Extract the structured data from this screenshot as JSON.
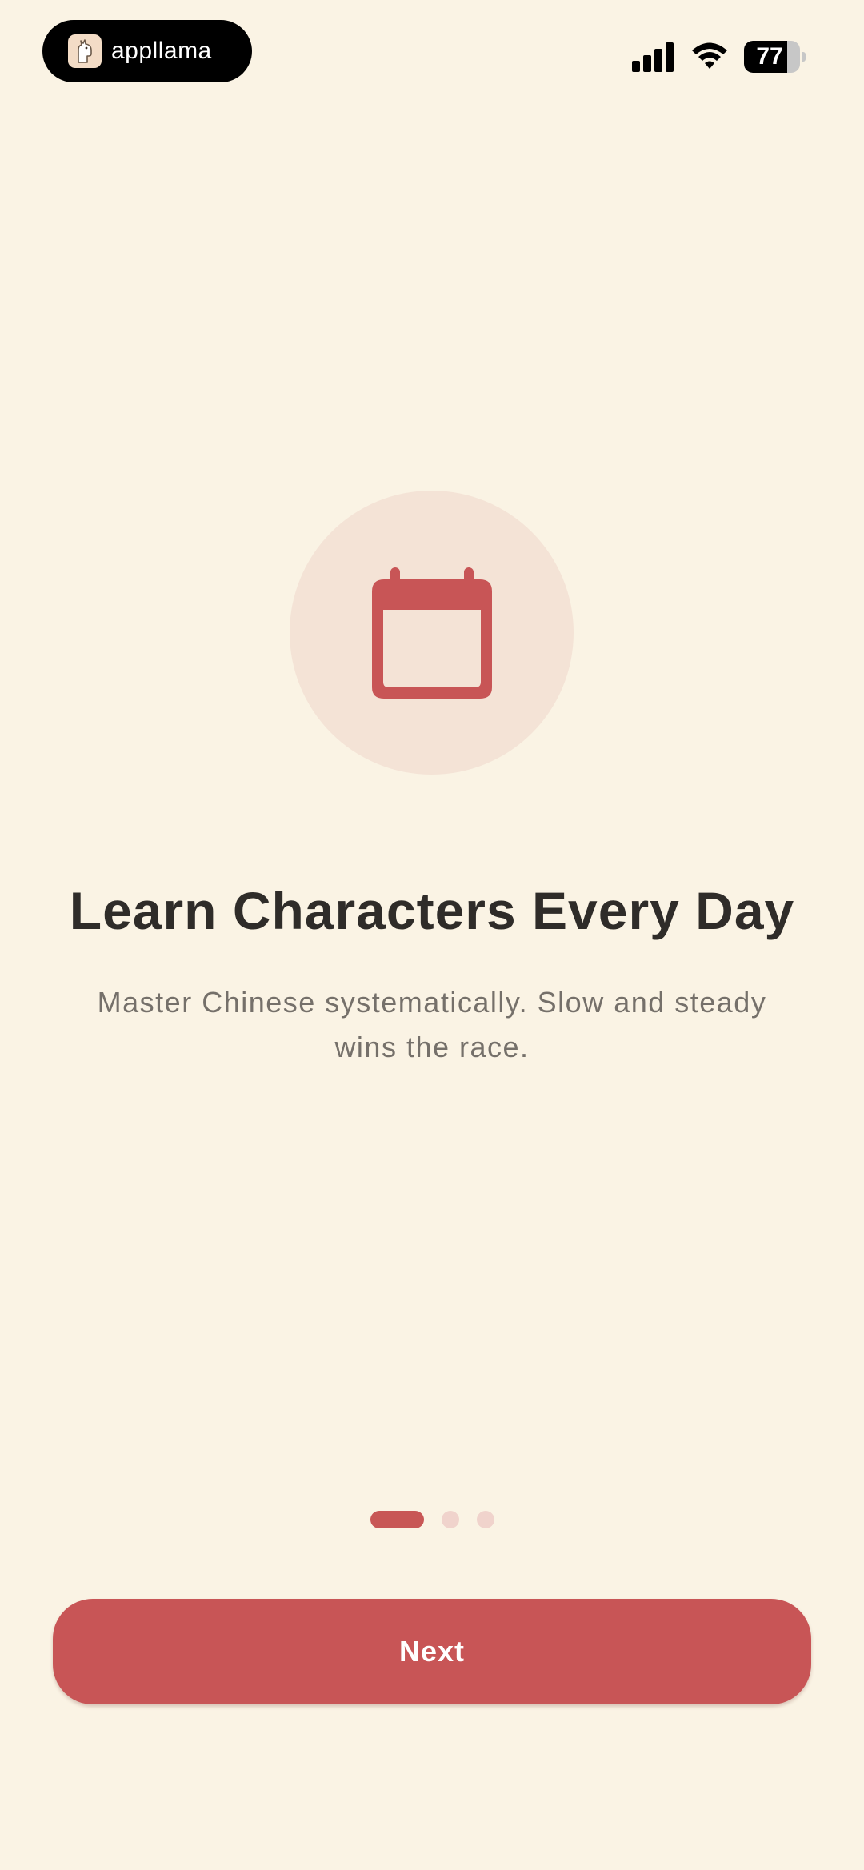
{
  "status_bar": {
    "app_name": "appllama",
    "battery_level": "77",
    "battery_fraction": 0.77,
    "signal_icon": "cellular-signal-icon",
    "wifi_icon": "wifi-icon"
  },
  "onboarding": {
    "icon": "calendar-icon",
    "title": "Learn Characters Every Day",
    "subtitle": "Master Chinese systematically. Slow and steady wins the race.",
    "page_count": 3,
    "current_page": 1
  },
  "actions": {
    "next_label": "Next"
  },
  "colors": {
    "background": "#FAF3E4",
    "accent": "#C85556",
    "icon_circle": "#F4E3D6",
    "inactive_dot": "#F0D3CC",
    "title_text": "#2F2C29",
    "subtitle_text": "#75706A"
  }
}
